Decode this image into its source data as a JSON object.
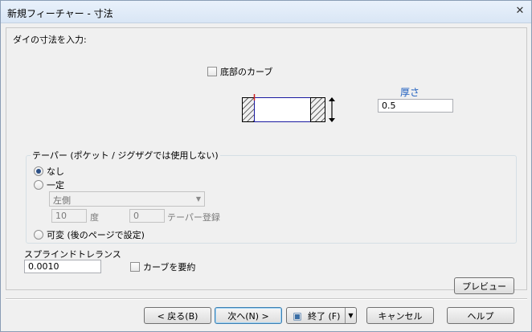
{
  "window": {
    "title": "新規フィーチャー - 寸法"
  },
  "form": {
    "prompt": "ダイの寸法を入力:",
    "bottom_curve_label": "底部のカーブ",
    "thickness_label": "厚さ",
    "thickness_value": "0.5",
    "taper_group_label": "テーパー (ポケット / ジグザグでは使用しない)",
    "taper_none_label": "なし",
    "taper_constant_label": "一定",
    "side_combo_value": "左側",
    "angle_value": "10",
    "angle_unit": "度",
    "taper_value": "0",
    "taper_register_label": "テーパー登録",
    "taper_variable_label": "可変 (後のページで設定)",
    "spline_tolerance_label": "スプラインドトレランス",
    "spline_tolerance_value": "0.0010",
    "curve_summary_label": "カーブを要約",
    "preview_button": "プレビュー"
  },
  "footer": {
    "back_button": "< 戻る(B)",
    "next_button": "次へ(N) >",
    "finish_button": "終了 (F)",
    "cancel_button": "キャンセル",
    "help_button": "ヘルプ"
  },
  "colors": {
    "title_bar": "#dbe7f6",
    "thickness_label": "#1f5fbf",
    "diagram_line": "#1a1aa0",
    "diagram_marker": "#d02020"
  },
  "icons": {
    "close": "close-icon",
    "finish": "finish-icon",
    "dropdown": "chevron-down-icon"
  }
}
